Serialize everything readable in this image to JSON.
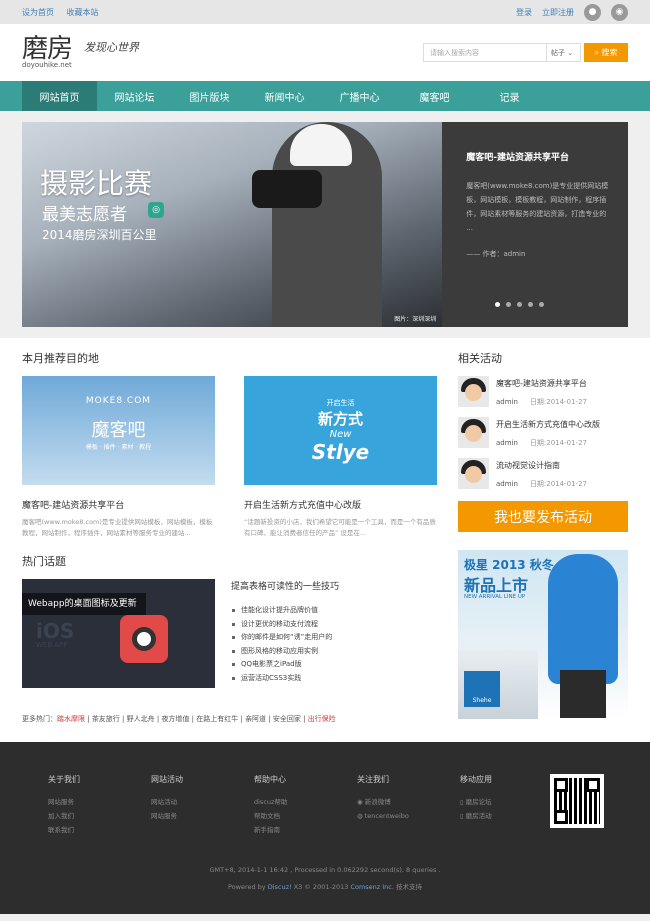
{
  "topbar": {
    "left": [
      "设为首页",
      "收藏本站"
    ],
    "right": [
      "登录",
      "立即注册"
    ]
  },
  "header": {
    "logo_cn": "磨房",
    "logo_en": "doyouhike.net",
    "slogan": "发现心世界",
    "search_placeholder": "请输入搜索内容",
    "search_type": "帖子",
    "search_button": "搜索"
  },
  "nav": [
    "网站首页",
    "网站论坛",
    "图片版块",
    "新闻中心",
    "广播中心",
    "魔客吧",
    "记录"
  ],
  "hero": {
    "line1": "摄影比赛",
    "line2": "最美志愿者",
    "line3": "2014磨房深圳百公里",
    "credit": "图片：深圳深圳",
    "title": "魔客吧-建站资源共享平台",
    "desc": "魔客吧(www.moke8.com)是专业提供网站模板，网站模板，模板教程，网站制作，程序插件，网站素材等服务的建站资源，打造专业的 ...",
    "author": "—— 作者：admin"
  },
  "recommend": {
    "title": "本月推荐目的地",
    "cards": [
      {
        "title": "魔客吧-建站资源共享平台",
        "desc": "魔客吧(www.moke8.com)是专业提供网站模板，网站模板，模板教程，网站制作，程序插件，网站素材等服务专业的建站...",
        "logo": "MOKE8.COM",
        "big": "魔客吧",
        "small": "模板 · 插件 · 素材 · 教程"
      },
      {
        "title": "开启生活新方式充值中心改版",
        "desc": "“话题新投资的小店，我们希望它可能是一个工具，而是一个有品质有口碑、能让消费者信任的产品” 设是在...",
        "a": "开启生活",
        "b": "新方式",
        "c": "New",
        "d": "Stlye"
      }
    ]
  },
  "hot": {
    "title": "热门话题",
    "caption": "Webapp的桌面图标及更新",
    "ios": "iOS",
    "ios_sub": "WEB APP",
    "list_title": "提高表格可读性的一些技巧",
    "items": [
      "佳能化设计提升品牌价值",
      "设计更优的移动支付流程",
      "你的邮件是如何“诱”走用户的",
      "图形风格的移动应用实例",
      "QQ电影票之iPad版",
      "运营活动CSS3实践"
    ]
  },
  "more": {
    "label": "更多热门：",
    "items": [
      "踏水摩限",
      "茶友旅行",
      "野人北舟",
      "夜方增值",
      "在路上有红牛",
      "亲阿道",
      "安全回家"
    ],
    "last": "出行保险"
  },
  "activity": {
    "title": "相关活动",
    "items": [
      {
        "title": "魔客吧-建站资源共享平台",
        "user": "admin",
        "date": "日期:2014-01-27"
      },
      {
        "title": "开启生活新方式充值中心改版",
        "user": "admin",
        "date": "日期:2014-01-27"
      },
      {
        "title": "流动视觉设计指南",
        "user": "admin",
        "date": "日期:2014-01-27"
      }
    ],
    "publish": "我也要发布活动"
  },
  "ad": {
    "t1": "极星 2013 秋冬",
    "t2": "新品上市",
    "t3": "NEW ARRIVAL LINE UP",
    "brand": "Shehe"
  },
  "footer": {
    "cols": [
      {
        "h": "关于我们",
        "items": [
          "网站服务",
          "加入我们",
          "联系我们"
        ]
      },
      {
        "h": "网站活动",
        "items": [
          "网站活动",
          "网站服务"
        ]
      },
      {
        "h": "帮助中心",
        "items": [
          "discuz帮助",
          "帮助文档",
          "新手指南"
        ]
      },
      {
        "h": "关注我们",
        "items": [
          "新浪微博",
          "tencentweibo"
        ]
      },
      {
        "h": "移动应用",
        "items": [
          "磨房论坛",
          "磨房活动"
        ]
      }
    ],
    "line1": "GMT+8, 2014-1-1 16:42 , Processed in 0.062292 second(s), 8 queries .",
    "line2a": "Powered by ",
    "line2b": "Discuz!",
    "line2c": " X3 © 2001-2013 ",
    "line2d": "Comsenz Inc.",
    "line2e": " 技术支持"
  }
}
